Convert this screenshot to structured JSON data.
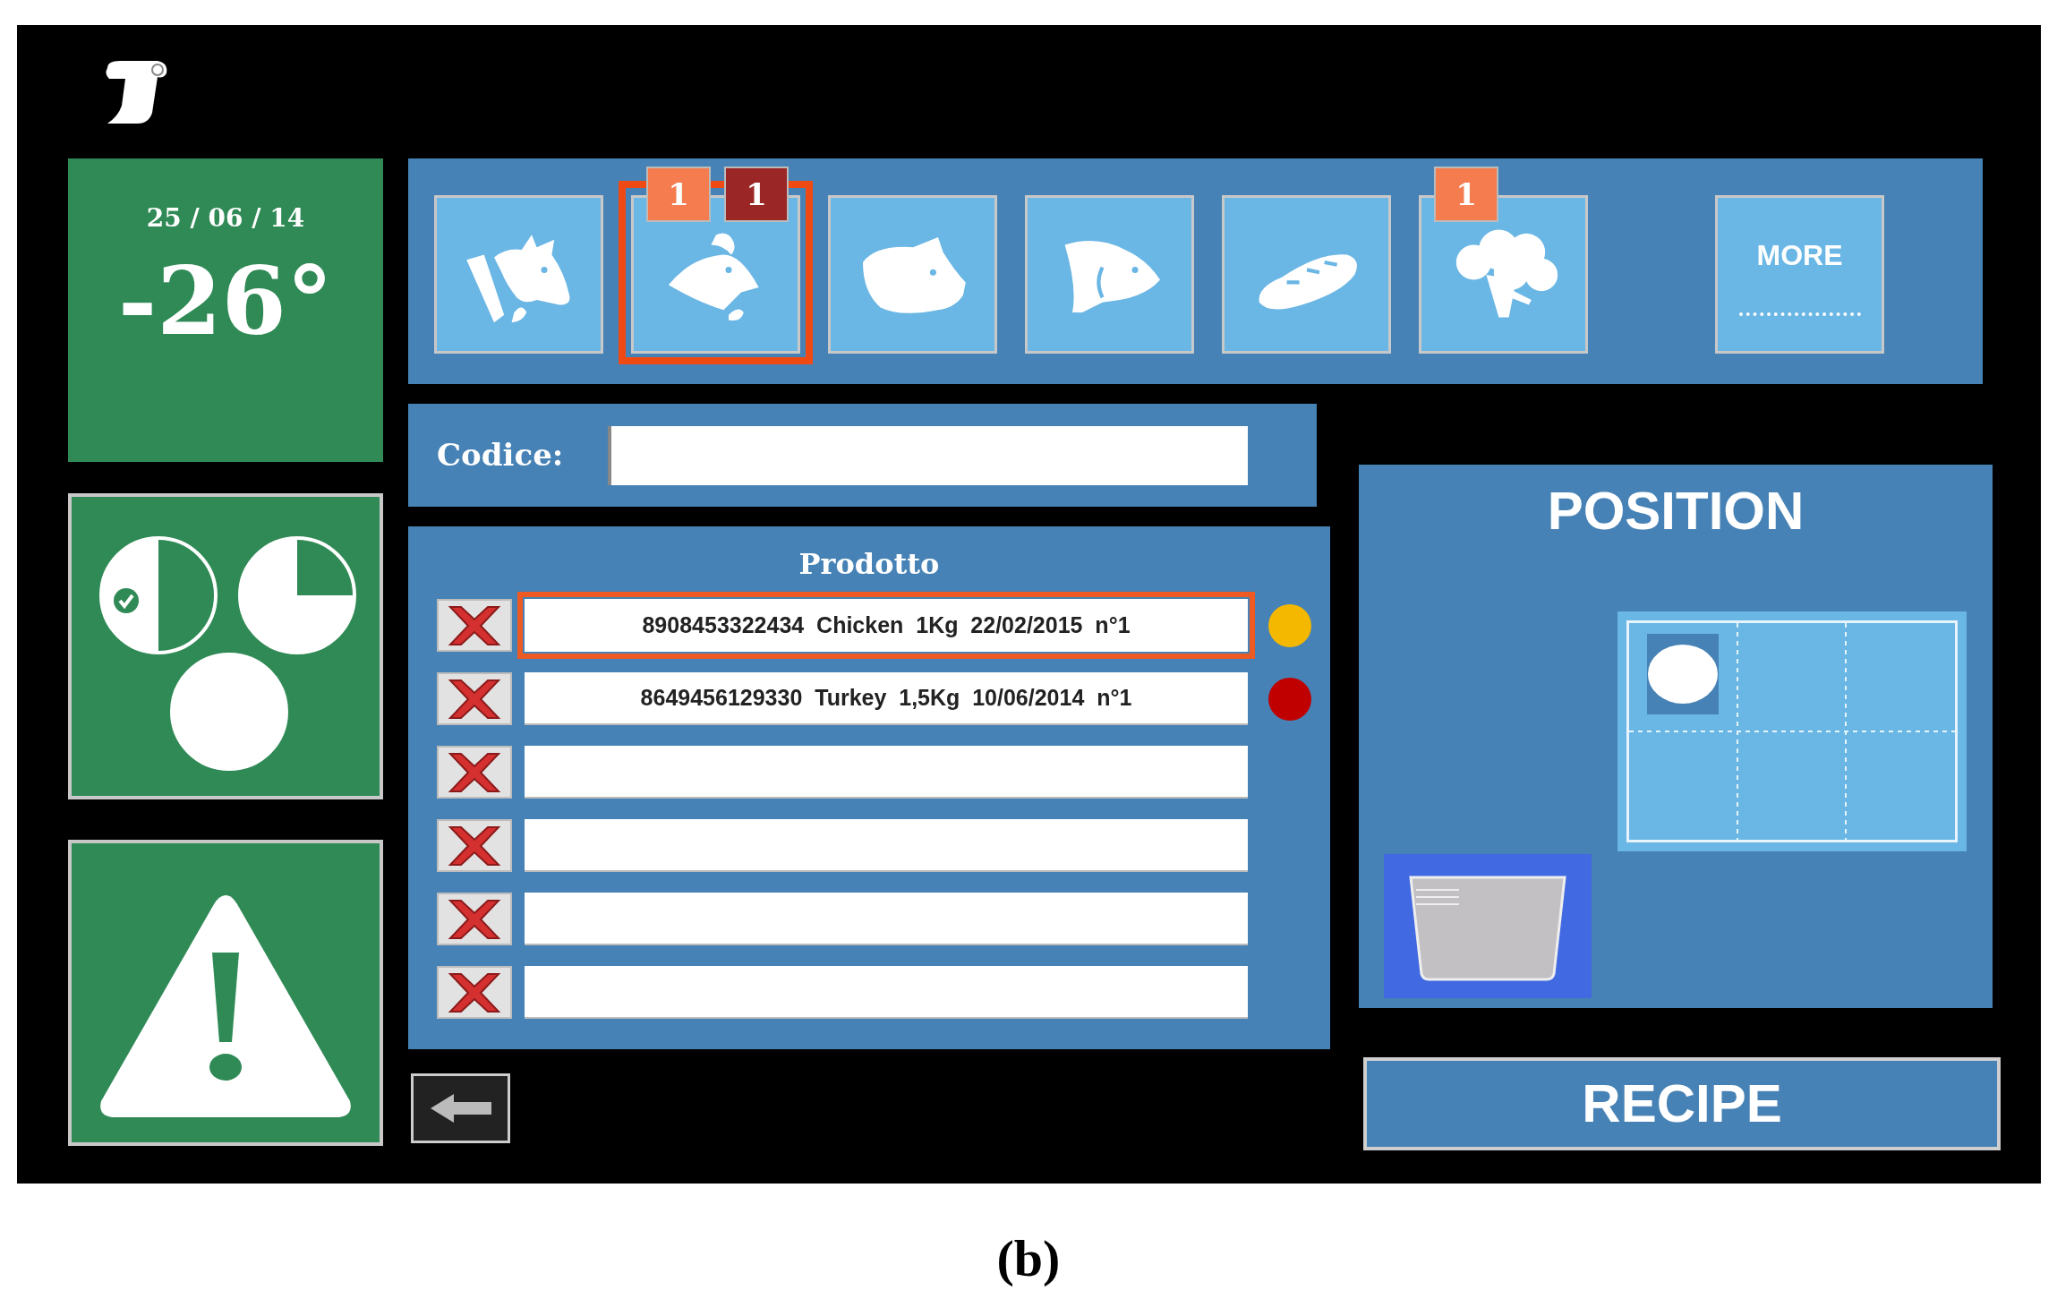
{
  "status": {
    "date": "25 / 06 / 14",
    "temperature": "-26°"
  },
  "pies": [
    {
      "kind": "half",
      "checked": true
    },
    {
      "kind": "three_quarter",
      "checked": false
    },
    {
      "kind": "full",
      "checked": false
    }
  ],
  "categories": [
    {
      "kind": "cow",
      "selected": false
    },
    {
      "kind": "chicken",
      "selected": true,
      "badges": [
        {
          "text": "1",
          "color": "#f47c4f"
        },
        {
          "text": "1",
          "color": "#9b2626"
        }
      ]
    },
    {
      "kind": "pig",
      "selected": false
    },
    {
      "kind": "fish",
      "selected": false
    },
    {
      "kind": "bread",
      "selected": false
    },
    {
      "kind": "broccoli",
      "selected": false,
      "badges": [
        {
          "text": "1",
          "color": "#f47c4f"
        }
      ]
    }
  ],
  "more_button": "MORE",
  "code_field": {
    "label": "Codice:"
  },
  "products": {
    "title": "Prodotto",
    "rows": [
      {
        "text": "8908453322434  Chicken  1Kg  22/02/2015  n°1",
        "selected": true,
        "color": "#f5b800"
      },
      {
        "text": "8649456129330  Turkey  1,5Kg  10/06/2014  n°1",
        "selected": false,
        "color": "#c00000"
      },
      {
        "selected": false
      },
      {
        "selected": false
      },
      {
        "selected": false
      },
      {
        "selected": false
      }
    ]
  },
  "position": {
    "title": "POSITION",
    "cells": [
      {
        "occupied": true
      },
      {
        "occupied": false
      },
      {
        "occupied": false
      },
      {
        "occupied": false
      },
      {
        "occupied": false
      },
      {
        "occupied": false
      }
    ]
  },
  "recipe_button": "RECIPE",
  "caption": "(b)"
}
